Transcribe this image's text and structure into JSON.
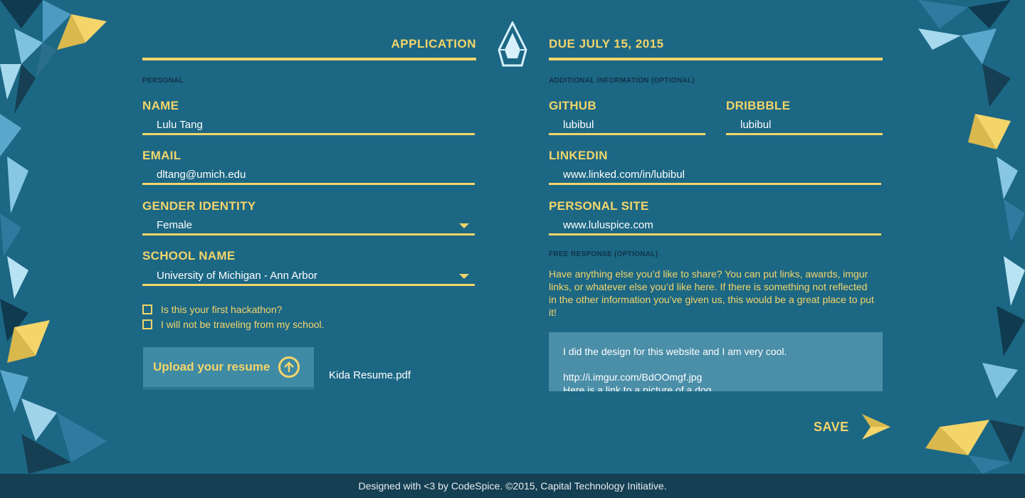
{
  "colors": {
    "background": "#1c6784",
    "accent": "#f3d56a",
    "footer": "#153f52",
    "textarea": "#4a8ea8"
  },
  "header": {
    "left_title": "APPLICATION",
    "right_title": "DUE JULY 15, 2015",
    "logo_icon": "crystal-logo-icon"
  },
  "personal": {
    "section_label": "PERSONAL",
    "name": {
      "label": "NAME",
      "value": "Lulu Tang"
    },
    "email": {
      "label": "EMAIL",
      "value": "dltang@umich.edu"
    },
    "gender": {
      "label": "GENDER IDENTITY",
      "value": "Female"
    },
    "school": {
      "label": "SCHOOL NAME",
      "value": "University of Michigan - Ann Arbor"
    },
    "checkboxes": [
      "Is this your first hackathon?",
      "I will not be traveling from my school."
    ],
    "upload": {
      "label": "Upload your resume",
      "file_name": "Kida Resume.pdf",
      "icon": "upload-arrow-icon"
    }
  },
  "additional": {
    "section_label": "ADDITIONAL INFORMATION (OPTIONAL)",
    "github": {
      "label": "GITHUB",
      "value": "lubibul"
    },
    "dribbble": {
      "label": "DRIBBBLE",
      "value": "lubibul"
    },
    "linkedin": {
      "label": "LINKEDIN",
      "value": "www.linked.com/in/lubibul"
    },
    "site": {
      "label": "PERSONAL SITE",
      "value": "www.luluspice.com"
    },
    "free_label": "FREE RESPONSE (OPTIONAL)",
    "free_prompt": "Have anything else you’d like to share? You can put links, awards, imgur links, or whatever else you’d like here. If there is something not reflected in the other information you’ve given us, this would be a great place to put it!",
    "free_text": "I did the design for this website and I am very cool.\n\nhttp://i.imgur.com/BdOOmgf.jpg\nHere is a link to a picture of a dog."
  },
  "save": {
    "label": "SAVE",
    "icon": "arrow-right-icon"
  },
  "footer": {
    "text": "Designed with <3 by CodeSpice. ©2015, Capital Technology Initiative."
  }
}
